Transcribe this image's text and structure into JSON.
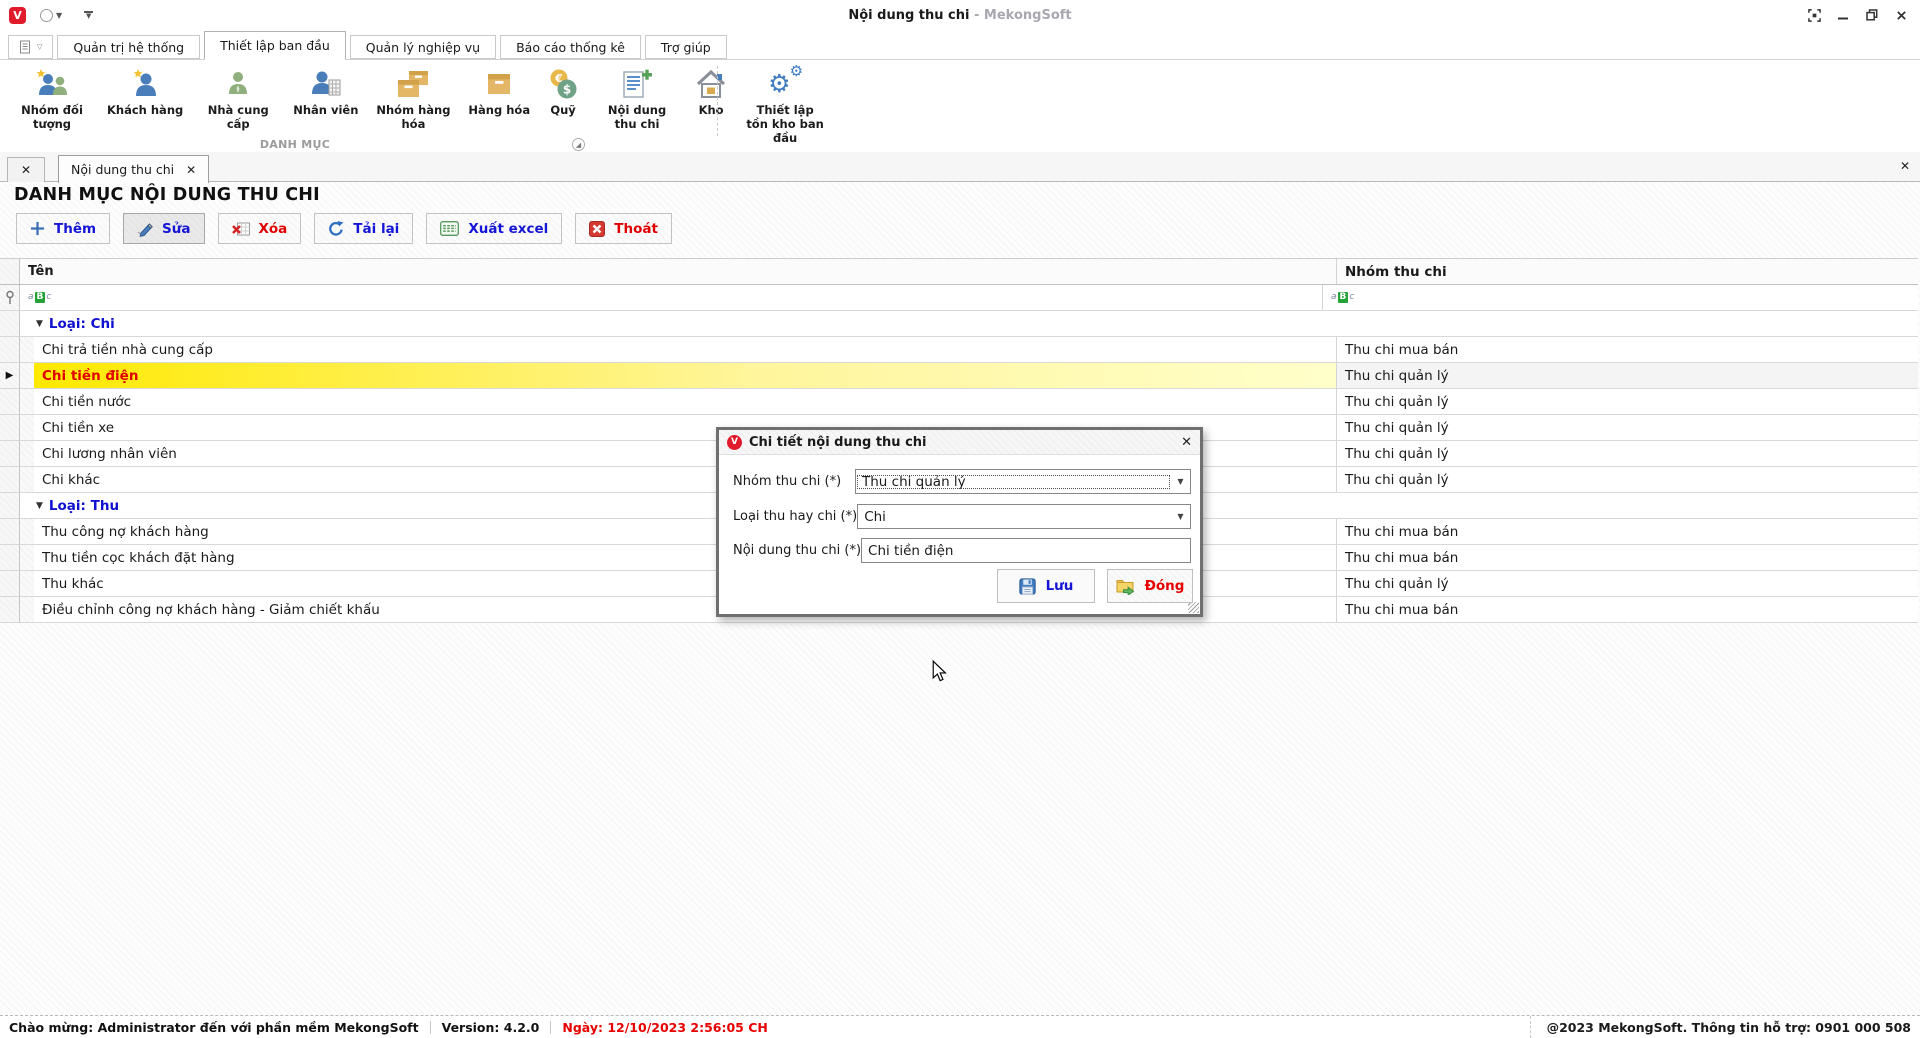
{
  "window": {
    "title": "Nội dung thu chi",
    "title_suffix": " - MekongSoft"
  },
  "ribbon": {
    "tabs": [
      {
        "label": "Quản trị hệ thống",
        "active": false
      },
      {
        "label": "Thiết lập ban đầu",
        "active": true
      },
      {
        "label": "Quản lý nghiệp vụ",
        "active": false
      },
      {
        "label": "Báo cáo thống kê",
        "active": false
      },
      {
        "label": "Trợ giúp",
        "active": false
      }
    ],
    "group_label": "DANH MỤC",
    "items": [
      {
        "label": "Nhóm đối tượng",
        "icon": "people-group"
      },
      {
        "label": "Khách hàng",
        "icon": "person-star"
      },
      {
        "label": "Nhà cung cấp",
        "icon": "person-green"
      },
      {
        "label": "Nhân viên",
        "icon": "person-doc"
      },
      {
        "label": "Nhóm hàng hóa",
        "icon": "boxes"
      },
      {
        "label": "Hàng hóa",
        "icon": "box"
      },
      {
        "label": "Quỹ",
        "icon": "coins"
      },
      {
        "label": "Nội dung thu chi",
        "icon": "doc-plus"
      },
      {
        "label": "Kho",
        "icon": "house"
      },
      {
        "label": "Thiết lập tồn kho ban đầu",
        "icon": "gears"
      }
    ]
  },
  "doc_tabs": {
    "close_all": "✕",
    "active_label": "Nội dung thu chi",
    "tab_close": "✕",
    "strip_close": "✕"
  },
  "page": {
    "title": "DANH MỤC NỘI DUNG THU CHI",
    "toolbar": [
      {
        "label": "Thêm",
        "icon": "plus",
        "color": "#1515d6",
        "pressed": false
      },
      {
        "label": "Sửa",
        "icon": "pencil",
        "color": "#1515d6",
        "pressed": true
      },
      {
        "label": "Xóa",
        "icon": "delete-table",
        "color": "#e00000",
        "pressed": false
      },
      {
        "label": "Tải lại",
        "icon": "refresh",
        "color": "#1515d6",
        "pressed": false
      },
      {
        "label": "Xuất excel",
        "icon": "excel",
        "color": "#1515d6",
        "pressed": false
      },
      {
        "label": "Thoát",
        "icon": "exit",
        "color": "#e00000",
        "pressed": false
      }
    ],
    "grid": {
      "columns": [
        "Tên",
        "Nhóm thu chi"
      ],
      "filter_glyph": {
        "a": "a",
        "b": "B",
        "c": "c"
      },
      "rows": [
        {
          "type": "group",
          "label": "Loại: Chi"
        },
        {
          "type": "data",
          "name": "Chi trả tiền nhà cung cấp",
          "group": "Thu chi mua bán",
          "selected": false
        },
        {
          "type": "data",
          "name": "Chi tiền điện",
          "group": "Thu chi quản lý",
          "selected": true
        },
        {
          "type": "data",
          "name": "Chi tiền nước",
          "group": "Thu chi quản lý",
          "selected": false
        },
        {
          "type": "data",
          "name": "Chi tiền xe",
          "group": "Thu chi quản lý",
          "selected": false
        },
        {
          "type": "data",
          "name": "Chi lương nhân viên",
          "group": "Thu chi quản lý",
          "selected": false
        },
        {
          "type": "data",
          "name": "Chi khác",
          "group": "Thu chi quản lý",
          "selected": false
        },
        {
          "type": "group",
          "label": "Loại: Thu"
        },
        {
          "type": "data",
          "name": "Thu công nợ khách hàng",
          "group": "Thu chi mua bán",
          "selected": false
        },
        {
          "type": "data",
          "name": "Thu tiền cọc khách đặt hàng",
          "group": "Thu chi mua bán",
          "selected": false
        },
        {
          "type": "data",
          "name": "Thu khác",
          "group": "Thu chi quản lý",
          "selected": false
        },
        {
          "type": "data",
          "name": "Điều chỉnh công nợ khách hàng - Giảm chiết khấu",
          "group": "Thu chi mua bán",
          "selected": false
        }
      ]
    }
  },
  "dialog": {
    "title": "Chi tiết nội dung thu chi",
    "close": "✕",
    "fields": [
      {
        "label": "Nhóm thu chi (*)",
        "value": "Thu chi quản lý",
        "type": "combo",
        "focused": true
      },
      {
        "label": "Loại thu hay chi (*)",
        "value": "Chi",
        "type": "combo",
        "focused": false
      },
      {
        "label": "Nội dung thu chi (*)",
        "value": "Chi tiền điện",
        "type": "text",
        "focused": false
      }
    ],
    "buttons": [
      {
        "label": "Lưu",
        "icon": "floppy",
        "color": "#1515d6"
      },
      {
        "label": "Đóng",
        "icon": "folder-go",
        "color": "#e80000"
      }
    ]
  },
  "status_bar": {
    "welcome": "Chào mừng: Administrator đến với phần mềm MekongSoft",
    "version": "Version: 4.2.0",
    "date": "Ngày: 12/10/2023 2:56:05 CH",
    "right": "@2023 MekongSoft. Thông tin hỗ trợ: 0901 000 508"
  }
}
